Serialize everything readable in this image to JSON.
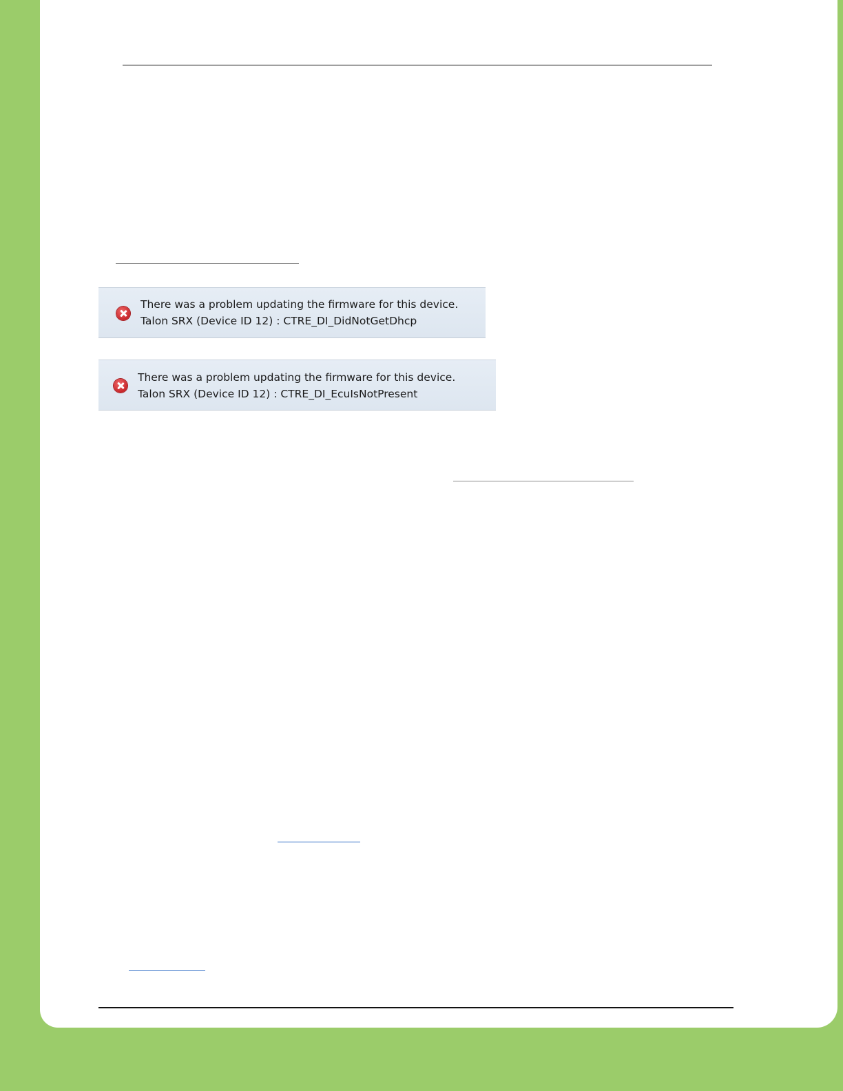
{
  "errors": [
    {
      "message": "There was a problem updating the firmware for this device.",
      "detail": "Talon SRX (Device ID 12) : CTRE_DI_DidNotGetDhcp"
    },
    {
      "message": "There was a problem updating the firmware for this device.",
      "detail": "Talon SRX (Device ID 12) : CTRE_DI_EcuIsNotPresent"
    }
  ],
  "icons": {
    "error": "error-icon"
  },
  "colors": {
    "page_background": "#9bcc6a",
    "banner_background": "#e2eaf3",
    "error_red": "#c8262a",
    "link_blue": "#2e6cc4"
  }
}
